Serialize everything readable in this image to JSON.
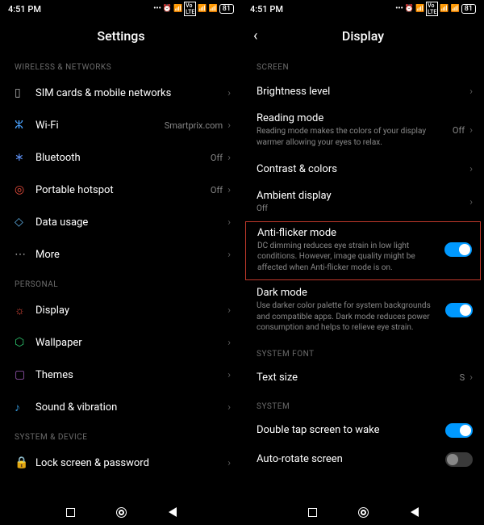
{
  "status": {
    "time": "4:51 PM",
    "battery": "81"
  },
  "left": {
    "title": "Settings",
    "sections": {
      "wireless": "WIRELESS & NETWORKS",
      "personal": "PERSONAL",
      "system": "SYSTEM & DEVICE"
    },
    "items": {
      "sim": "SIM cards & mobile networks",
      "wifi": "Wi-Fi",
      "wifi_value": "Smartprix.com",
      "bluetooth": "Bluetooth",
      "bluetooth_value": "Off",
      "hotspot": "Portable hotspot",
      "hotspot_value": "Off",
      "data": "Data usage",
      "more": "More",
      "display": "Display",
      "wallpaper": "Wallpaper",
      "themes": "Themes",
      "sound": "Sound & vibration",
      "lock": "Lock screen & password"
    }
  },
  "right": {
    "title": "Display",
    "sections": {
      "screen": "SCREEN",
      "font": "SYSTEM FONT",
      "system": "SYSTEM"
    },
    "items": {
      "brightness": "Brightness level",
      "reading": "Reading mode",
      "reading_value": "Off",
      "reading_sub": "Reading mode makes the colors of your display warmer allowing your eyes to relax.",
      "contrast": "Contrast & colors",
      "ambient": "Ambient display",
      "ambient_sub": "Off",
      "antiflicker": "Anti-flicker mode",
      "antiflicker_sub": "DC dimming reduces eye strain in low light conditions. However, image quality might be affected when Anti-flicker mode is on.",
      "dark": "Dark mode",
      "dark_sub": "Use darker color palette for system backgrounds and compatible apps. Dark mode reduces power consumption and helps to relieve eye strain.",
      "textsize": "Text size",
      "textsize_value": "S",
      "doubletap": "Double tap screen to wake",
      "autorotate": "Auto-rotate screen"
    }
  }
}
